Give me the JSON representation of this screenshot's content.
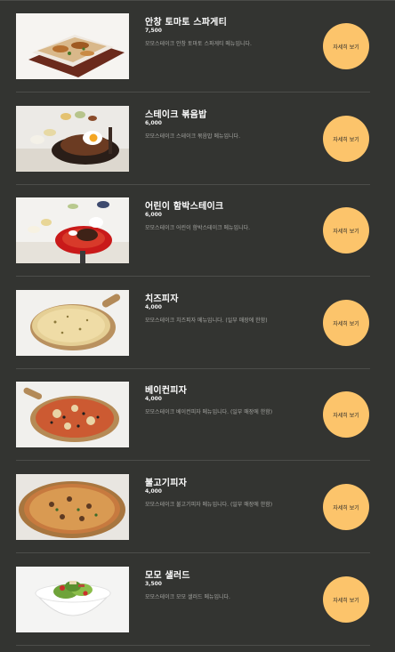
{
  "menu": {
    "detail_label": "자세히 보기",
    "items": [
      {
        "title": "안창 토마토 스파게티",
        "price": "7,500",
        "desc": "모모스테이크 안창 토마토 스파게티 메뉴입니다."
      },
      {
        "title": "스테이크 볶음밥",
        "price": "6,000",
        "desc": "모모스테이크 스테이크 볶음밥 메뉴입니다."
      },
      {
        "title": "어린이 함박스테이크",
        "price": "6,000",
        "desc": "모모스테이크 어린이 함박스테이크 메뉴입니다."
      },
      {
        "title": "치즈피자",
        "price": "4,000",
        "desc": "모모스테이크 치즈피자 메뉴입니다. (일부 매장에 한함)"
      },
      {
        "title": "베이컨피자",
        "price": "4,000",
        "desc": "모모스테이크 베이컨피자 메뉴입니다. (일부 매장에 한함)"
      },
      {
        "title": "불고기피자",
        "price": "4,000",
        "desc": "모모스테이크 불고기피자 메뉴입니다. (일부 매장에 한함)"
      },
      {
        "title": "모모 샐러드",
        "price": "3,500",
        "desc": "모모스테이크 모모 샐러드 메뉴입니다."
      }
    ]
  }
}
